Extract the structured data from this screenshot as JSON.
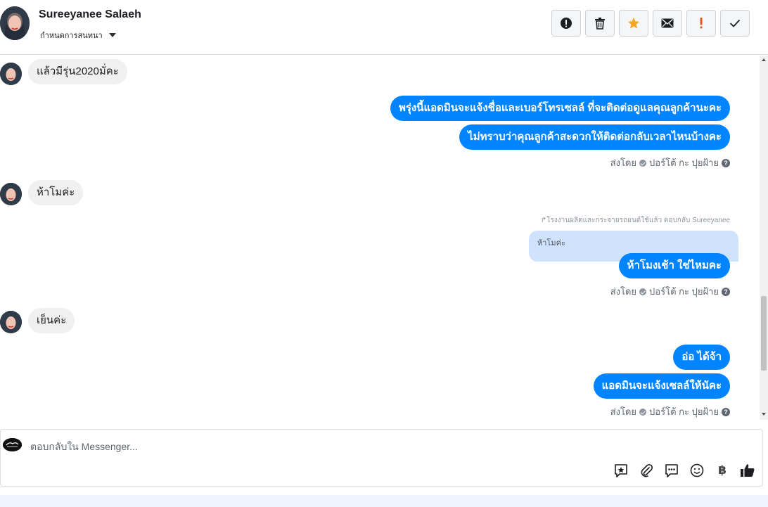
{
  "header": {
    "contact_name": "Sureeyanee Salaeh",
    "assign_label": "กำหนดการสนทนา",
    "toolbar_icons": [
      "report-icon",
      "trash-icon",
      "star-icon",
      "mail-icon",
      "important-icon",
      "check-icon"
    ]
  },
  "messages": {
    "m1": "แล้วมีรุ่น2020มั่คะ",
    "m2": "พรุ่งนี้แอดมินจะแจ้งชื่อและเบอร์โทรเซลล์ ที่จะติดต่อดูแลคุณลูกค้านะคะ",
    "m3": "ไม่ทราบว่าคุณลูกค้าสะดวกให้ติดต่อกลับเวลาไหนบ้างคะ",
    "m4": "ห้าโมค่ะ",
    "reply_note": "↱โรงงานผลิตและกระจายรถยนต์ใช้แล้ว ตอบกลับ Sureeyanee",
    "quoted": "ห้าโมค่ะ",
    "m5": "ห้าโมงเช้า ใช่ไหมคะ",
    "m6": "เย็นค่ะ",
    "m7": "อ่อ  ได้จ้า",
    "m8": "แอดมินจะแจ้งเซลล์ให้นัคะ",
    "sent_by_prefix": "ส่งโดย",
    "sent_by_name": "ปอร์โต้ กะ ปุยฝ้าย",
    "help_mark": "?"
  },
  "composer": {
    "placeholder": "ตอบกลับใน Messenger...",
    "tools": [
      "saved-reply-icon",
      "attachment-icon",
      "quick-reply-icon",
      "emoji-icon",
      "baht-icon",
      "like-icon"
    ],
    "baht": "฿"
  }
}
